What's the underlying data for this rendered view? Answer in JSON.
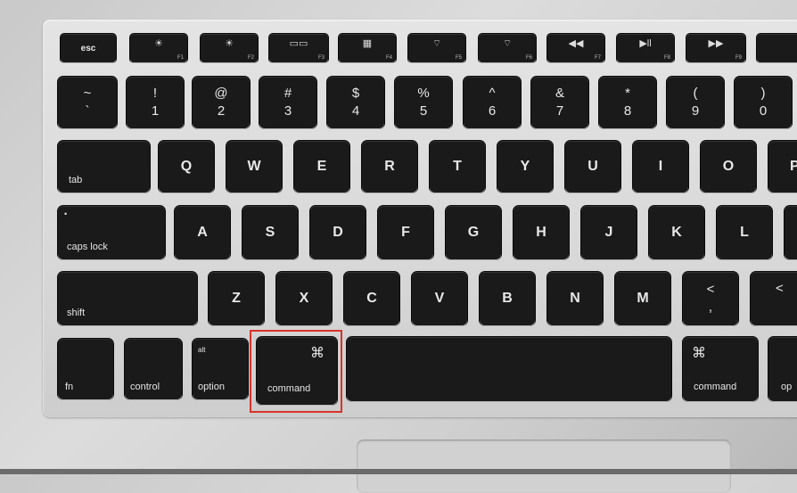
{
  "fkeys": [
    {
      "label": "esc",
      "fn": ""
    },
    {
      "label": "☀",
      "fn": "F1"
    },
    {
      "label": "☀",
      "fn": "F2"
    },
    {
      "label": "▭▭",
      "fn": "F3"
    },
    {
      "label": "▦",
      "fn": "F4"
    },
    {
      "label": "⌔",
      "fn": "F5"
    },
    {
      "label": "⌔",
      "fn": "F6"
    },
    {
      "label": "◀◀",
      "fn": "F7"
    },
    {
      "label": "▶ll",
      "fn": "F8"
    },
    {
      "label": "▶▶",
      "fn": "F9"
    }
  ],
  "number_row": [
    {
      "top": "~",
      "bottom": "`"
    },
    {
      "top": "!",
      "bottom": "1"
    },
    {
      "top": "@",
      "bottom": "2"
    },
    {
      "top": "#",
      "bottom": "3"
    },
    {
      "top": "$",
      "bottom": "4"
    },
    {
      "top": "%",
      "bottom": "5"
    },
    {
      "top": "^",
      "bottom": "6"
    },
    {
      "top": "&",
      "bottom": "7"
    },
    {
      "top": "*",
      "bottom": "8"
    },
    {
      "top": "(",
      "bottom": "9"
    },
    {
      "top": ")",
      "bottom": "0"
    }
  ],
  "qwerty_row": {
    "tab": "tab",
    "letters": [
      "Q",
      "W",
      "E",
      "R",
      "T",
      "Y",
      "U",
      "I",
      "O",
      "P"
    ]
  },
  "home_row": {
    "caps": "caps lock",
    "letters": [
      "A",
      "S",
      "D",
      "F",
      "G",
      "H",
      "J",
      "K",
      "L"
    ]
  },
  "bottom_row": {
    "shift": "shift",
    "letters": [
      "Z",
      "X",
      "C",
      "V",
      "B",
      "N",
      "M"
    ],
    "comma": {
      "top": "<",
      "bottom": ","
    },
    "period_top": "<"
  },
  "modifiers": {
    "fn": "fn",
    "control": "control",
    "option": "option",
    "option_alt": "alt",
    "command": "command",
    "command_symbol": "⌘",
    "right_command": "command",
    "right_option": "op"
  },
  "highlight_color": "#d8332b"
}
